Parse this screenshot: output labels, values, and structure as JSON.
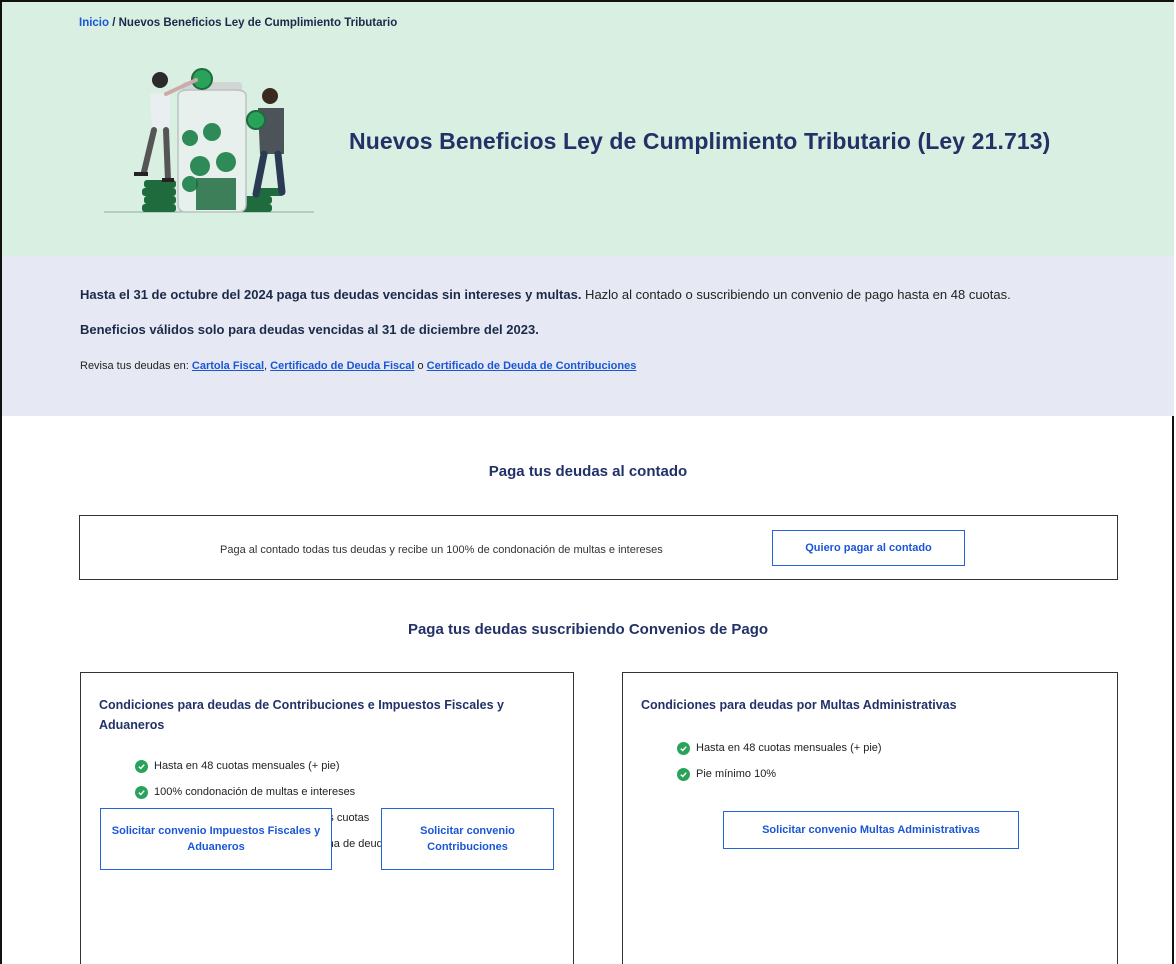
{
  "breadcrumb": {
    "home": "Inicio",
    "sep": " / ",
    "current": "Nuevos Beneficios Ley de Cumplimiento Tributario"
  },
  "hero": {
    "title": "Nuevos Beneficios Ley de Cumplimiento Tributario (Ley 21.713)"
  },
  "info": {
    "line1_bold": "Hasta el 31 de octubre del 2024 paga tus deudas vencidas sin intereses y multas.",
    "line1_rest": " Hazlo al contado o suscribiendo un convenio de pago hasta en 48 cuotas.",
    "line2": "Beneficios válidos solo para deudas vencidas al 31 de diciembre del 2023.",
    "line3_prefix": "Revisa tus deudas en: ",
    "link1": "Cartola Fiscal",
    "sep1": ", ",
    "link2": "Certificado de Deuda Fiscal",
    "sep2": " o ",
    "link3": "Certificado de Deuda de Contribuciones"
  },
  "contado": {
    "heading": "Paga tus deudas al contado",
    "text": "Paga al contado todas tus deudas y recibe un 100% de condonación de multas e intereses",
    "button": "Quiero pagar al contado"
  },
  "convenios": {
    "heading": "Paga tus deudas suscribiendo Convenios de Pago",
    "card1": {
      "title": "Condiciones para deudas de Contribuciones e Impuestos Fiscales y Aduaneros",
      "items": [
        "Hasta en 48 cuotas mensuales (+ pie)",
        "100% condonación de multas e intereses",
        "0% de interés si mantienes al día tus cuotas",
        "Pie desde 0% hasta 10% según fecha de deuda"
      ],
      "button1": "Solicitar convenio Impuestos Fiscales y Aduaneros",
      "button2": "Solicitar convenio Contribuciones"
    },
    "card2": {
      "title": "Condiciones para deudas por Multas Administrativas",
      "items": [
        "Hasta en 48 cuotas mensuales (+ pie)",
        "Pie mínimo 10%"
      ],
      "button": "Solicitar convenio Multas Administrativas"
    }
  },
  "colors": {
    "hero_bg": "#d8efe2",
    "info_bg": "#e6e9f4",
    "title": "#223267",
    "link": "#1a56d6",
    "check": "#2aa35a"
  },
  "icons": {
    "check": "check-circle-icon",
    "illustration": "savings-jar-illustration"
  }
}
